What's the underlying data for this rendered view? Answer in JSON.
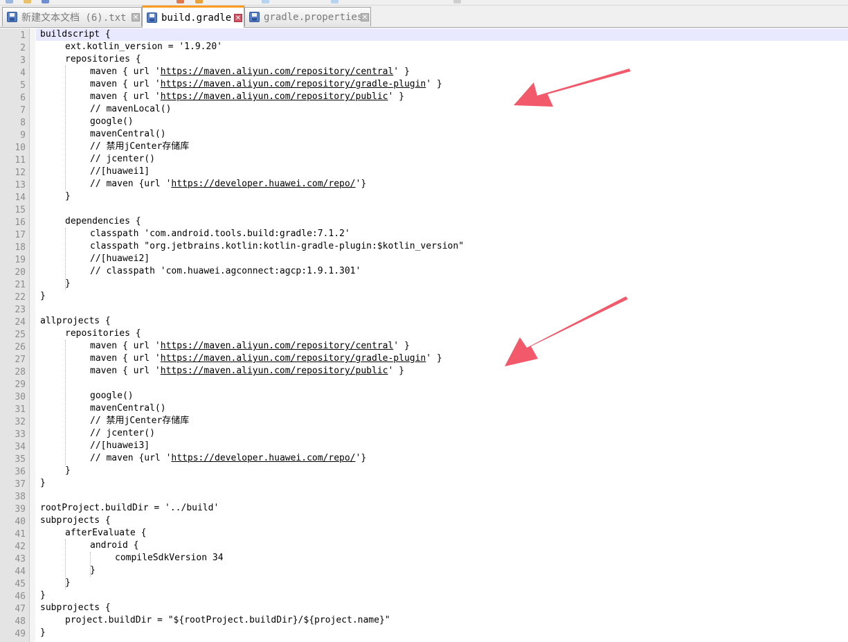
{
  "tabs": [
    {
      "label": "新建文本文档 (6).txt",
      "active": false
    },
    {
      "label": "build.gradle",
      "active": true
    },
    {
      "label": "gradle.properties",
      "active": false
    }
  ],
  "lines": [
    {
      "n": "1",
      "indent": 0,
      "text": "buildscript {"
    },
    {
      "n": "2",
      "indent": 1,
      "text": "ext.kotlin_version = '1.9.20'"
    },
    {
      "n": "3",
      "indent": 1,
      "text": "repositories {"
    },
    {
      "n": "4",
      "indent": 2,
      "pre": "maven { url '",
      "url": "https://maven.aliyun.com/repository/central",
      "post": "' }"
    },
    {
      "n": "5",
      "indent": 2,
      "pre": "maven { url '",
      "url": "https://maven.aliyun.com/repository/gradle-plugin",
      "post": "' }"
    },
    {
      "n": "6",
      "indent": 2,
      "pre": "maven { url '",
      "url": "https://maven.aliyun.com/repository/public",
      "post": "' }"
    },
    {
      "n": "7",
      "indent": 2,
      "text": "// mavenLocal()"
    },
    {
      "n": "8",
      "indent": 2,
      "text": "google()"
    },
    {
      "n": "9",
      "indent": 2,
      "text": "mavenCentral()"
    },
    {
      "n": "10",
      "indent": 2,
      "text": "// 禁用jCenter存储库"
    },
    {
      "n": "11",
      "indent": 2,
      "text": "// jcenter()"
    },
    {
      "n": "12",
      "indent": 2,
      "text": "//[huawei1]"
    },
    {
      "n": "13",
      "indent": 2,
      "pre": "// maven {url '",
      "url": "https://developer.huawei.com/repo/",
      "post": "'}"
    },
    {
      "n": "14",
      "indent": 1,
      "text": "}"
    },
    {
      "n": "15",
      "indent": 0,
      "text": ""
    },
    {
      "n": "16",
      "indent": 1,
      "text": "dependencies {"
    },
    {
      "n": "17",
      "indent": 2,
      "text": "classpath 'com.android.tools.build:gradle:7.1.2'"
    },
    {
      "n": "18",
      "indent": 2,
      "text": "classpath \"org.jetbrains.kotlin:kotlin-gradle-plugin:$kotlin_version\""
    },
    {
      "n": "19",
      "indent": 2,
      "text": "//[huawei2]"
    },
    {
      "n": "20",
      "indent": 2,
      "text": "// classpath 'com.huawei.agconnect:agcp:1.9.1.301'"
    },
    {
      "n": "21",
      "indent": 1,
      "text": "}"
    },
    {
      "n": "22",
      "indent": 0,
      "text": "}"
    },
    {
      "n": "23",
      "indent": 0,
      "text": ""
    },
    {
      "n": "24",
      "indent": 0,
      "text": "allprojects {"
    },
    {
      "n": "25",
      "indent": 1,
      "text": "repositories {"
    },
    {
      "n": "26",
      "indent": 2,
      "pre": "maven { url '",
      "url": "https://maven.aliyun.com/repository/central",
      "post": "' }"
    },
    {
      "n": "27",
      "indent": 2,
      "pre": "maven { url '",
      "url": "https://maven.aliyun.com/repository/gradle-plugin",
      "post": "' }"
    },
    {
      "n": "28",
      "indent": 2,
      "pre": "maven { url '",
      "url": "https://maven.aliyun.com/repository/public",
      "post": "' }"
    },
    {
      "n": "29",
      "indent": 0,
      "text": ""
    },
    {
      "n": "30",
      "indent": 2,
      "text": "google()"
    },
    {
      "n": "31",
      "indent": 2,
      "text": "mavenCentral()"
    },
    {
      "n": "32",
      "indent": 2,
      "text": "// 禁用jCenter存储库"
    },
    {
      "n": "33",
      "indent": 2,
      "text": "// jcenter()"
    },
    {
      "n": "34",
      "indent": 2,
      "text": "//[huawei3]"
    },
    {
      "n": "35",
      "indent": 2,
      "pre": "// maven {url '",
      "url": "https://developer.huawei.com/repo/",
      "post": "'}"
    },
    {
      "n": "36",
      "indent": 1,
      "text": "}"
    },
    {
      "n": "37",
      "indent": 0,
      "text": "}"
    },
    {
      "n": "38",
      "indent": 0,
      "text": ""
    },
    {
      "n": "39",
      "indent": 0,
      "text": "rootProject.buildDir = '../build'"
    },
    {
      "n": "40",
      "indent": 0,
      "text": "subprojects {"
    },
    {
      "n": "41",
      "indent": 1,
      "text": "afterEvaluate {"
    },
    {
      "n": "42",
      "indent": 2,
      "text": "android {"
    },
    {
      "n": "43",
      "indent": 3,
      "text": "compileSdkVersion 34"
    },
    {
      "n": "44",
      "indent": 2,
      "text": "}"
    },
    {
      "n": "45",
      "indent": 1,
      "text": "}"
    },
    {
      "n": "46",
      "indent": 0,
      "text": "}"
    },
    {
      "n": "47",
      "indent": 0,
      "text": "subprojects {"
    },
    {
      "n": "48",
      "indent": 1,
      "text": "project.buildDir = \"${rootProject.buildDir}/${project.name}\""
    },
    {
      "n": "49",
      "indent": 0,
      "text": "}"
    }
  ],
  "current_line": "1",
  "colors": {
    "gutter": "#e4e4e4",
    "line_number": "#8c8c8c",
    "current_line": "#e8e8ff",
    "active_tab_accent": "#fa9a1e",
    "close_active": "#d15665",
    "arrow": "#f25a6b"
  },
  "icons": [
    "save-icon",
    "close-icon"
  ]
}
